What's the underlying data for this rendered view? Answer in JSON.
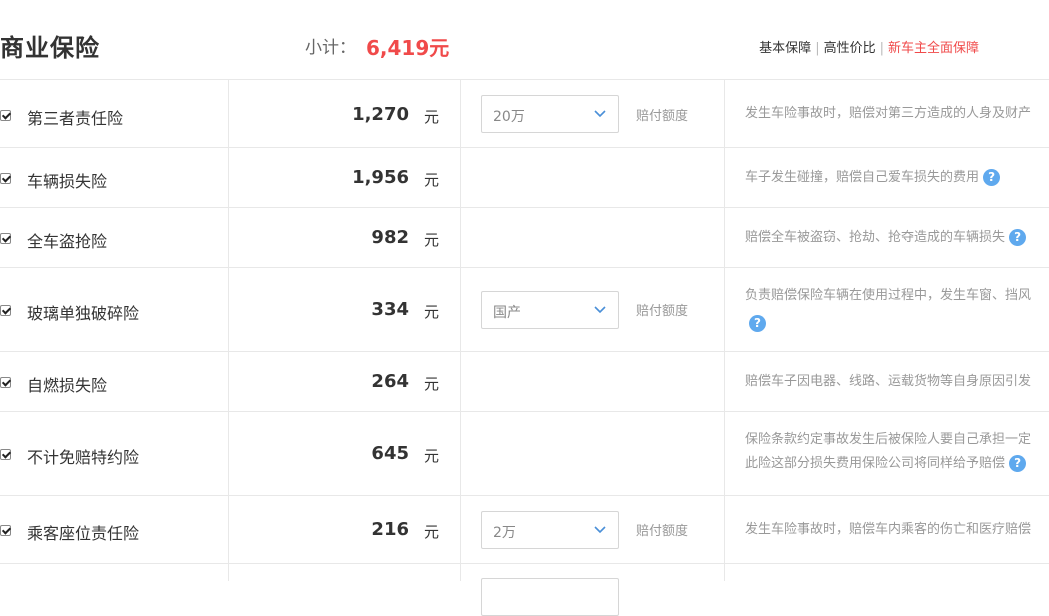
{
  "header": {
    "title": "商业保险",
    "subtotal_label": "小计：",
    "subtotal_amount": "6,419元",
    "plans": [
      "基本保障",
      "高性价比",
      "新车主全面保障"
    ]
  },
  "unit": "元",
  "coverage_label": "赔付额度",
  "help_glyph": "?",
  "rows": [
    {
      "name": "第三者责任险",
      "price": "1,270",
      "select": "20万",
      "desc": [
        "发生车险事故时，赔偿对第三方造成的人身及财产"
      ]
    },
    {
      "name": "车辆损失险",
      "price": "1,956",
      "desc": [
        "车子发生碰撞，赔偿自己爱车损失的费用"
      ]
    },
    {
      "name": "全车盗抢险",
      "price": "982",
      "desc": [
        "赔偿全车被盗窃、抢劫、抢夺造成的车辆损失"
      ]
    },
    {
      "name": "玻璃单独破碎险",
      "price": "334",
      "select": "国产",
      "desc": [
        "负责赔偿保险车辆在使用过程中，发生车窗、挡风"
      ]
    },
    {
      "name": "自燃损失险",
      "price": "264",
      "desc": [
        "赔偿车子因电器、线路、运载货物等自身原因引发"
      ]
    },
    {
      "name": "不计免赔特约险",
      "price": "645",
      "desc": [
        "保险条款约定事故发生后被保险人要自己承担一定",
        "此险这部分损失费用保险公司将同样给予赔偿"
      ]
    },
    {
      "name": "乘客座位责任险",
      "price": "216",
      "select": "2万",
      "desc": [
        "发生车险事故时，赔偿车内乘客的伤亡和医疗赔偿"
      ]
    }
  ],
  "colors": {
    "accent_red": "#f04a4a",
    "help_blue": "#5fa9ee",
    "border": "#e8e8e8"
  }
}
